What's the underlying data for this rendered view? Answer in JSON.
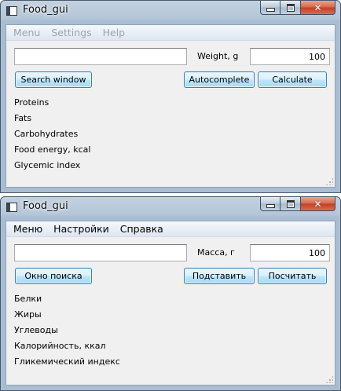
{
  "windows": [
    {
      "title": "Food_gui",
      "menu": [
        "Menu",
        "Settings",
        "Help"
      ],
      "search_value": "",
      "weight_label": "Weight, g",
      "weight_value": "100",
      "buttons": {
        "search": "Search window",
        "autocomplete": "Autocomplete",
        "calculate": "Calculate"
      },
      "nutrients": [
        "Proteins",
        "Fats",
        "Carbohydrates",
        "Food energy, kcal",
        "Glycemic index"
      ]
    },
    {
      "title": "Food_gui",
      "menu": [
        "Меню",
        "Настройки",
        "Справка"
      ],
      "search_value": "",
      "weight_label": "Масса, г",
      "weight_value": "100",
      "buttons": {
        "search": "Окно поиска",
        "autocomplete": "Подставить",
        "calculate": "Посчитать"
      },
      "nutrients": [
        "Белки",
        "Жиры",
        "Углеводы",
        "Калорийность, ккал",
        "Гликемический индекс"
      ]
    }
  ],
  "icons": {
    "app": "window-app-icon",
    "minimize": "minimize-icon",
    "maximize": "maximize-icon",
    "close": "close-icon",
    "grip": "resize-grip-icon"
  },
  "colors": {
    "titlebar": "#b4c6d8",
    "client_bg": "#f0f0f0",
    "button_border": "#3c7fb1",
    "close_button": "#c23e22",
    "disabled_menu_text": "#9aa3ad"
  }
}
